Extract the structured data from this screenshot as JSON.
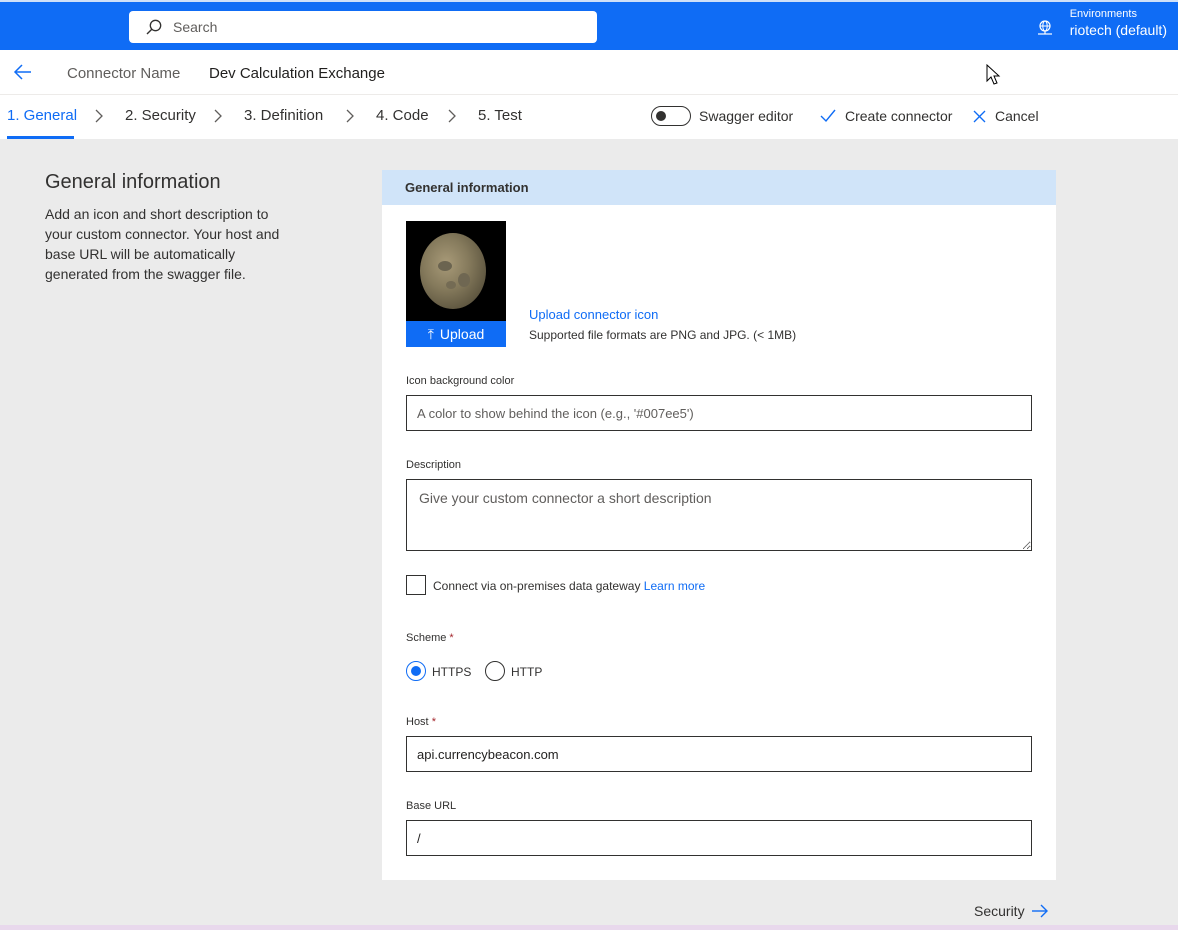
{
  "topbar": {
    "search_placeholder": "Search",
    "env_label": "Environments",
    "env_value": "riotech (default)",
    "accent": "#0f6cf5"
  },
  "header": {
    "connector_name_label": "Connector Name",
    "connector_name_value": "Dev Calculation Exchange"
  },
  "tabs": [
    {
      "label": "1. General"
    },
    {
      "label": "2. Security"
    },
    {
      "label": "3. Definition"
    },
    {
      "label": "4. Code"
    },
    {
      "label": "5. Test"
    }
  ],
  "actions": {
    "swagger_label": "Swagger editor",
    "swagger_on": false,
    "create_label": "Create connector",
    "cancel_label": "Cancel"
  },
  "side": {
    "title": "General information",
    "description": "Add an icon and short description to your custom connector. Your host and base URL will be automatically generated from the swagger file."
  },
  "card": {
    "heading": "General information",
    "upload_button": "Upload",
    "upload_link": "Upload connector icon",
    "upload_hint": "Supported file formats are PNG and JPG. (< 1MB)",
    "icon_bg_label": "Icon background color",
    "icon_bg_placeholder": "A color to show behind the icon (e.g., '#007ee5')",
    "description_label": "Description",
    "description_placeholder": "Give your custom connector a short description",
    "gateway_label": "Connect via on-premises data gateway",
    "gateway_link": "Learn more",
    "gateway_checked": false,
    "scheme_label": "Scheme",
    "scheme_required": "*",
    "scheme_options": [
      "HTTPS",
      "HTTP"
    ],
    "scheme_selected": "HTTPS",
    "host_label": "Host",
    "host_required": "*",
    "host_value": "api.currencybeacon.com",
    "base_url_label": "Base URL",
    "base_url_value": "/"
  },
  "footer": {
    "next_label": "Security"
  }
}
